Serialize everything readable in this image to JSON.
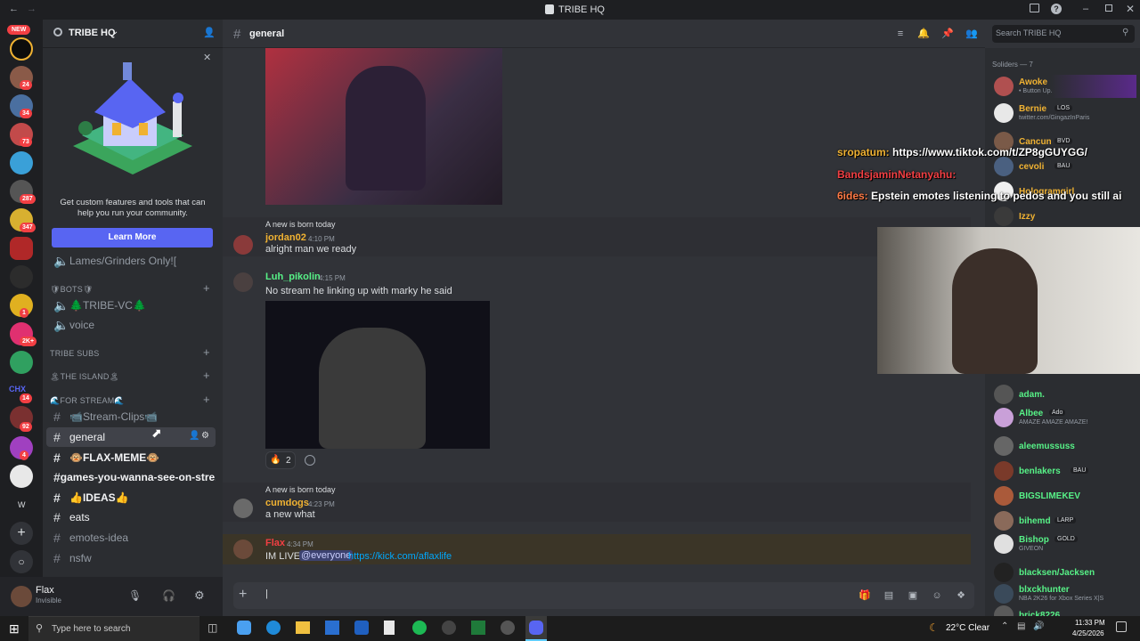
{
  "titlebar": {
    "title": "TRIBE HQ"
  },
  "servers": {
    "new_badge": "NEW",
    "badges": [
      "24",
      "34",
      "73",
      "287",
      "347",
      "1",
      "2K+",
      "14",
      "92",
      "4"
    ],
    "w_label": "W"
  },
  "channels": {
    "server_name": "TRIBE HQ",
    "promo_text": "Get custom features and tools that can help you run your community.",
    "promo_button": "Learn More",
    "items": [
      {
        "label": "Lames/Grinders Only!["
      },
      {
        "label": "🛡BOTS🛡"
      },
      {
        "label": "🌲TRIBE-VC🌲"
      },
      {
        "label": "voice"
      },
      {
        "label": "TRIBE SUBS"
      },
      {
        "label": "🏝THE ISLAND🏝"
      },
      {
        "label": "🌊FOR STREAM🌊"
      },
      {
        "label": "📹Stream-Clips📹"
      },
      {
        "label": "general"
      },
      {
        "label": "🐵FLAX-MEME🐵"
      },
      {
        "label": "games-you-wanna-see-on-stre..."
      },
      {
        "label": "👍IDEAS👍"
      },
      {
        "label": "eats"
      },
      {
        "label": "emotes-idea"
      },
      {
        "label": "nsfw"
      }
    ]
  },
  "user": {
    "name": "Flax",
    "status": "Invisible"
  },
  "chat": {
    "channel": "general",
    "search_placeholder": "Search TRIBE HQ",
    "messages": [
      {
        "reply": "A new is born today",
        "name": "jordan02",
        "time": "4:10 PM",
        "text": "alright man we ready",
        "color": "#f0b232"
      },
      {
        "name": "Luh_pikolin",
        "time": "4:15 PM",
        "text": "No stream he linking up with marky he said",
        "color": "#57f287"
      },
      {
        "reply": "A new is born today",
        "name": "cumdogs",
        "time": "4:23 PM",
        "text": "a new what",
        "color": "#f0b232"
      },
      {
        "name": "Flax",
        "time": "4:34 PM",
        "text_pre": "IM LIVE",
        "mention": "@everyone",
        "link": "https://kick.com/aflaxlife",
        "color": "#f23f43"
      }
    ],
    "reaction_count": "2"
  },
  "overlay": {
    "lines": [
      {
        "user": "sropatum:",
        "text": "https://www.tiktok.com/t/ZP8gGUYGG/"
      },
      {
        "user": "BandsjaminNetanyahu:",
        "text": ""
      },
      {
        "user": "6ides:",
        "text": "Epstein emotes listening to pedos and you still ai"
      }
    ]
  },
  "members": {
    "header": "Soliders — 7",
    "list": [
      {
        "name": "Awoke",
        "status": "• Button Up.",
        "color": "#f0b232"
      },
      {
        "name": "Bernie",
        "tag": "LOS",
        "status": "twitter.com/GingazInParis",
        "color": "#f0b232"
      },
      {
        "name": "Cancun",
        "tag": "BVD",
        "status": "",
        "color": "#f0b232"
      },
      {
        "name": "cevoli",
        "tag": "BAU",
        "status": "",
        "color": "#f0b232"
      },
      {
        "name": "Hologramgirl",
        "status": "",
        "color": "#f0b232"
      },
      {
        "name": "Izzy",
        "status": "",
        "color": "#f0b232"
      },
      {
        "name": "adam.",
        "status": "",
        "color": "#57f287"
      },
      {
        "name": "Albee",
        "tag": "Ado",
        "status": "AMAZE AMAZE AMAZE!",
        "color": "#57f287"
      },
      {
        "name": "aleemussuss",
        "status": "",
        "color": "#57f287"
      },
      {
        "name": "benlakers",
        "tag": "BAU",
        "status": "",
        "color": "#57f287"
      },
      {
        "name": "BIGSLIMEKEV",
        "status": "",
        "color": "#57f287"
      },
      {
        "name": "bihemd",
        "tag": "LARP",
        "status": "",
        "color": "#57f287"
      },
      {
        "name": "Bishop",
        "tag": "GOLD",
        "status": "GIVEON",
        "color": "#57f287"
      },
      {
        "name": "blacksen/Jacksen",
        "status": "",
        "color": "#57f287"
      },
      {
        "name": "blxckhunter",
        "status": "NBA 2K26 for Xbox Series X|S",
        "color": "#57f287"
      },
      {
        "name": "brick8226",
        "status": "",
        "color": "#57f287"
      }
    ]
  },
  "taskbar": {
    "search_placeholder": "Type here to search",
    "weather": "22°C  Clear",
    "time": "11:33 PM",
    "date": "4/25/2026"
  }
}
